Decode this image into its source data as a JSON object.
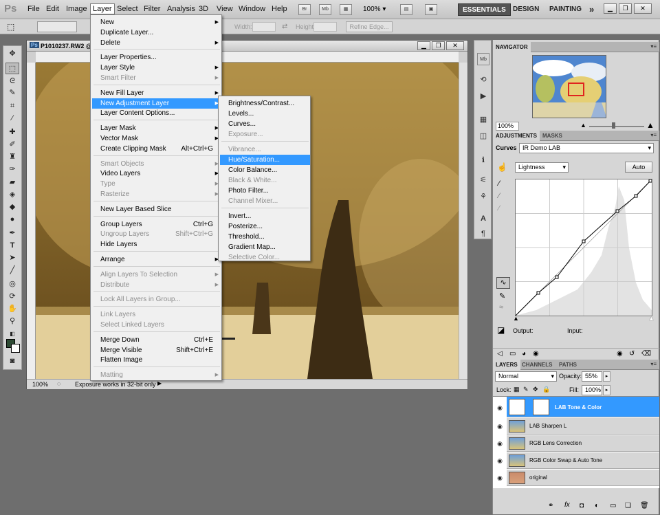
{
  "app": {
    "logo": "Ps"
  },
  "menubar": {
    "items": [
      "File",
      "Edit",
      "Image",
      "Layer",
      "Select",
      "Filter",
      "Analysis",
      "3D",
      "View",
      "Window",
      "Help"
    ],
    "bridge": "Br",
    "minibridge": "Mb",
    "zoom": "100%",
    "workspaces": [
      "ESSENTIALS",
      "DESIGN",
      "PAINTING"
    ],
    "more": "»"
  },
  "options": {
    "width_label": "Width:",
    "height_label": "Height:",
    "refine_edge": "Refine Edge..."
  },
  "document": {
    "title": "P1010237.RW2 @",
    "zoom": "100%",
    "status": "Exposure works in 32-bit only"
  },
  "layer_menu": [
    {
      "label": "New",
      "sub": true
    },
    {
      "label": "Duplicate Layer..."
    },
    {
      "label": "Delete",
      "sub": true
    },
    {
      "sep": true
    },
    {
      "label": "Layer Properties..."
    },
    {
      "label": "Layer Style",
      "sub": true
    },
    {
      "label": "Smart Filter",
      "sub": true,
      "disabled": true
    },
    {
      "sep": true
    },
    {
      "label": "New Fill Layer",
      "sub": true
    },
    {
      "label": "New Adjustment Layer",
      "sub": true,
      "highlight": true
    },
    {
      "label": "Layer Content Options..."
    },
    {
      "sep": true
    },
    {
      "label": "Layer Mask",
      "sub": true
    },
    {
      "label": "Vector Mask",
      "sub": true
    },
    {
      "label": "Create Clipping Mask",
      "shortcut": "Alt+Ctrl+G"
    },
    {
      "sep": true
    },
    {
      "label": "Smart Objects",
      "sub": true,
      "disabled": true
    },
    {
      "label": "Video Layers",
      "sub": true
    },
    {
      "label": "Type",
      "sub": true,
      "disabled": true
    },
    {
      "label": "Rasterize",
      "sub": true,
      "disabled": true
    },
    {
      "sep": true
    },
    {
      "label": "New Layer Based Slice"
    },
    {
      "sep": true
    },
    {
      "label": "Group Layers",
      "shortcut": "Ctrl+G"
    },
    {
      "label": "Ungroup Layers",
      "shortcut": "Shift+Ctrl+G",
      "disabled": true
    },
    {
      "label": "Hide Layers"
    },
    {
      "sep": true
    },
    {
      "label": "Arrange",
      "sub": true
    },
    {
      "sep": true
    },
    {
      "label": "Align Layers To Selection",
      "sub": true,
      "disabled": true
    },
    {
      "label": "Distribute",
      "sub": true,
      "disabled": true
    },
    {
      "sep": true
    },
    {
      "label": "Lock All Layers in Group...",
      "disabled": true
    },
    {
      "sep": true
    },
    {
      "label": "Link Layers",
      "disabled": true
    },
    {
      "label": "Select Linked Layers",
      "disabled": true
    },
    {
      "sep": true
    },
    {
      "label": "Merge Down",
      "shortcut": "Ctrl+E"
    },
    {
      "label": "Merge Visible",
      "shortcut": "Shift+Ctrl+E"
    },
    {
      "label": "Flatten Image"
    },
    {
      "sep": true
    },
    {
      "label": "Matting",
      "sub": true,
      "disabled": true
    }
  ],
  "adjustment_submenu": [
    {
      "label": "Brightness/Contrast..."
    },
    {
      "label": "Levels..."
    },
    {
      "label": "Curves..."
    },
    {
      "label": "Exposure...",
      "disabled": true
    },
    {
      "sep": true
    },
    {
      "label": "Vibrance...",
      "disabled": true
    },
    {
      "label": "Hue/Saturation...",
      "highlight": true
    },
    {
      "label": "Color Balance..."
    },
    {
      "label": "Black & White...",
      "disabled": true
    },
    {
      "label": "Photo Filter..."
    },
    {
      "label": "Channel Mixer...",
      "disabled": true
    },
    {
      "sep": true
    },
    {
      "label": "Invert..."
    },
    {
      "label": "Posterize..."
    },
    {
      "label": "Threshold..."
    },
    {
      "label": "Gradient Map..."
    },
    {
      "label": "Selective Color...",
      "disabled": true
    }
  ],
  "navigator": {
    "tab": "NAVIGATOR",
    "zoom": "100%"
  },
  "adjustments": {
    "tabs": [
      "ADJUSTMENTS",
      "MASKS"
    ],
    "type": "Curves",
    "preset": "IR Demo LAB",
    "channel": "Lightness",
    "auto": "Auto",
    "output_label": "Output:",
    "input_label": "Input:"
  },
  "layers": {
    "tabs": [
      "LAYERS",
      "CHANNELS",
      "PATHS"
    ],
    "blend": "Normal",
    "opacity_label": "Opacity:",
    "opacity": "55%",
    "lock_label": "Lock:",
    "fill_label": "Fill:",
    "fill": "100%",
    "items": [
      {
        "name": "LAB Tone & Color",
        "selected": true
      },
      {
        "name": "LAB Sharpen L"
      },
      {
        "name": "RGB Lens Correction"
      },
      {
        "name": "RGB Color Swap & Auto Tone"
      },
      {
        "name": "original"
      }
    ]
  },
  "colors": {
    "accent": "#3399ff",
    "foreground": "#2d4a33",
    "background": "#ffffff"
  }
}
